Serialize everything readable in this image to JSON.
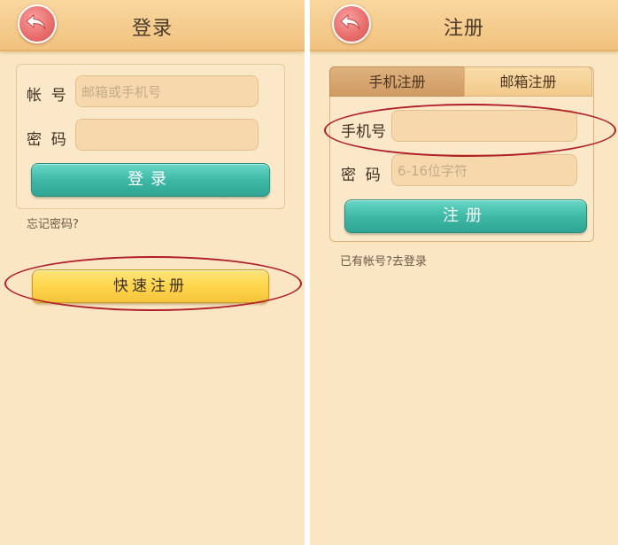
{
  "login_screen": {
    "title": "登录",
    "account_label": "帐  号",
    "account_placeholder": "邮箱或手机号",
    "password_label": "密  码",
    "password_placeholder": "",
    "login_button": "登录",
    "forgot_password": "忘记密码?",
    "quick_register_button": "快速注册"
  },
  "register_screen": {
    "title": "注册",
    "tabs": [
      "手机注册",
      "邮箱注册"
    ],
    "active_tab": "手机注册",
    "phone_label": "手机号",
    "phone_placeholder": "",
    "password_label": "密  码",
    "password_placeholder": "6-16位字符",
    "register_button": "注册",
    "have_account_link": "已有帐号?去登录"
  },
  "colors": {
    "background": "#fbe6c3",
    "header": "#f4c98a",
    "teal_button": "#3eb9a6",
    "yellow_button": "#ffd64d",
    "back_button": "#e8706d",
    "highlight_ellipse": "#b01e2a"
  },
  "icons": {
    "back": "back-arrow-icon"
  }
}
